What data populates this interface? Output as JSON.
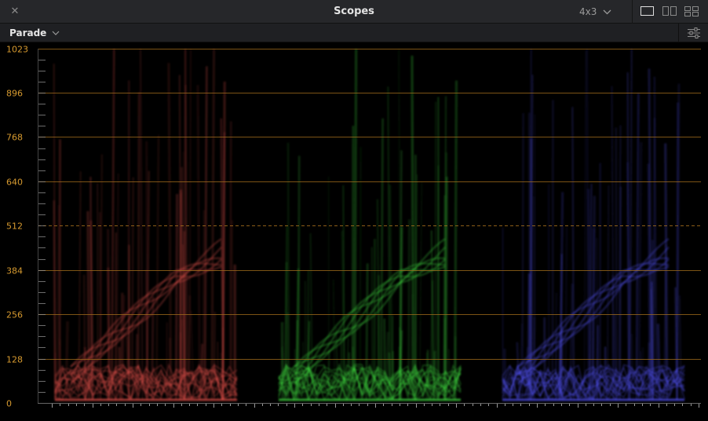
{
  "window": {
    "title": "Scopes",
    "aspect_ratio": "4x3",
    "layouts": [
      {
        "name": "single",
        "active": true
      },
      {
        "name": "dual",
        "active": false
      },
      {
        "name": "quad",
        "active": false
      }
    ]
  },
  "scope": {
    "mode": "Parade",
    "scale_labels": [
      "1023",
      "896",
      "768",
      "640",
      "512",
      "384",
      "256",
      "128",
      "0"
    ],
    "scale_min": 0,
    "scale_max": 1023,
    "midline_value": 512,
    "channels": [
      {
        "name": "red",
        "color": "#e0504a"
      },
      {
        "name": "green",
        "color": "#3ed63e"
      },
      {
        "name": "blue",
        "color": "#5050ee"
      }
    ]
  },
  "colors": {
    "graticule": "#a56f1c",
    "label": "#d79a2f",
    "titlebar": "#26272a"
  }
}
